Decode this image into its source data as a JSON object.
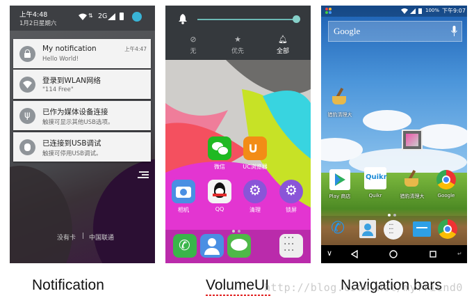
{
  "captions": {
    "notification": "Notification",
    "volume": "VolumeUI",
    "navigation": "Navigation bars"
  },
  "watermark": "http://blog.csdn.net/myfriend0",
  "notification_panel": {
    "status": {
      "time": "上午4:48",
      "date": "1月2日星期六",
      "network": "2G"
    },
    "notifications": [
      {
        "title": "My notification",
        "subtitle": "Hello World!",
        "time": "上午4:47",
        "icon": "lock-icon"
      },
      {
        "title": "登录到WLAN网络",
        "subtitle": "\"114 Free\"",
        "icon": "wifi-icon"
      },
      {
        "title": "已作为媒体设备连接",
        "subtitle": "触摸可显示其他USB选项。",
        "icon": "usb-icon"
      },
      {
        "title": "已连接到USB调试",
        "subtitle": "触摸可停用USB调试。",
        "icon": "debug-icon"
      }
    ],
    "carrier": {
      "sim1": "没有卡",
      "separator": "|",
      "sim2": "中国联通"
    }
  },
  "volume_panel": {
    "slider_level": 0.95,
    "modes": [
      {
        "label": "无",
        "icon": "block-icon"
      },
      {
        "label": "优先",
        "icon": "star-icon"
      },
      {
        "label": "全部",
        "icon": "bell-icon"
      }
    ],
    "apps_row1": [
      {
        "label": "微信",
        "color": "#1fb922"
      },
      {
        "label": "UC浏览器",
        "color": "#f28c16"
      }
    ],
    "apps_row2": [
      {
        "label": "相机",
        "color": "#4a8fe3"
      },
      {
        "label": "QQ",
        "color": "#f4f4f4"
      },
      {
        "label": "清理",
        "color": "#8a55d8"
      },
      {
        "label": "锁屏",
        "color": "#8a55d8"
      }
    ],
    "dock": [
      {
        "icon": "phone-icon",
        "color": "#39b54a"
      },
      {
        "icon": "contacts-icon",
        "color": "#4a8fe3"
      },
      {
        "icon": "messages-icon",
        "color": "#4fb848"
      },
      {
        "icon": "apps-icon",
        "color": "#eeeeee"
      }
    ]
  },
  "navigation_panel": {
    "status": {
      "battery": "100%",
      "time": "下午9:07"
    },
    "search_placeholder": "Google",
    "apps": [
      {
        "label": "猎豹清理大",
        "color": "#2e86de"
      },
      {
        "label": "Play 商店",
        "color": "#ffffff"
      },
      {
        "label": "Quikr",
        "color": "#ffffff"
      },
      {
        "label": "猎豹清理大",
        "color": "#2e86de"
      },
      {
        "label": "Google",
        "color": "#ffffff"
      }
    ],
    "quikr_text": "Quikr"
  }
}
